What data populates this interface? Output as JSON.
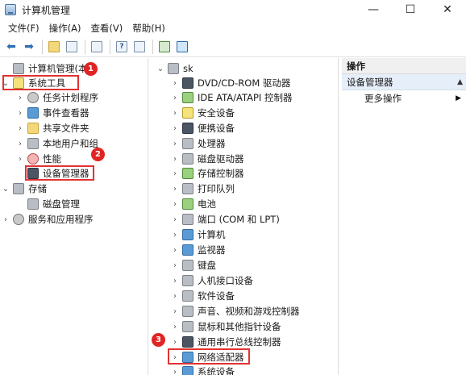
{
  "window": {
    "title": "计算机管理",
    "minimize": "—",
    "maximize": "☐",
    "close": "✕"
  },
  "menu": [
    "文件(F)",
    "操作(A)",
    "查看(V)",
    "帮助(H)"
  ],
  "left_tree": [
    {
      "label": "计算机管理(本地",
      "icon": "computer-management-icon"
    },
    {
      "label": "系统工具",
      "icon": "system-tools-icon"
    },
    {
      "label": "任务计划程序",
      "icon": "task-scheduler-icon"
    },
    {
      "label": "事件查看器",
      "icon": "event-viewer-icon"
    },
    {
      "label": "共享文件夹",
      "icon": "shared-folder-icon"
    },
    {
      "label": "本地用户和组",
      "icon": "users-icon"
    },
    {
      "label": "性能",
      "icon": "performance-icon"
    },
    {
      "label": "设备管理器",
      "icon": "device-manager-icon"
    },
    {
      "label": "存储",
      "icon": "storage-icon"
    },
    {
      "label": "磁盘管理",
      "icon": "disk-management-icon"
    },
    {
      "label": "服务和应用程序",
      "icon": "services-icon"
    }
  ],
  "devices": {
    "root": "sk",
    "items": [
      "DVD/CD-ROM 驱动器",
      "IDE ATA/ATAPI 控制器",
      "安全设备",
      "便携设备",
      "处理器",
      "磁盘驱动器",
      "存储控制器",
      "打印队列",
      "电池",
      "端口 (COM 和 LPT)",
      "计算机",
      "监视器",
      "键盘",
      "人机接口设备",
      "软件设备",
      "声音、视频和游戏控制器",
      "鼠标和其他指针设备",
      "通用串行总线控制器",
      "网络适配器",
      "系统设备"
    ]
  },
  "actions": {
    "header": "操作",
    "section": "设备管理器",
    "more": "更多操作"
  },
  "badges": [
    "1",
    "2",
    "3"
  ]
}
